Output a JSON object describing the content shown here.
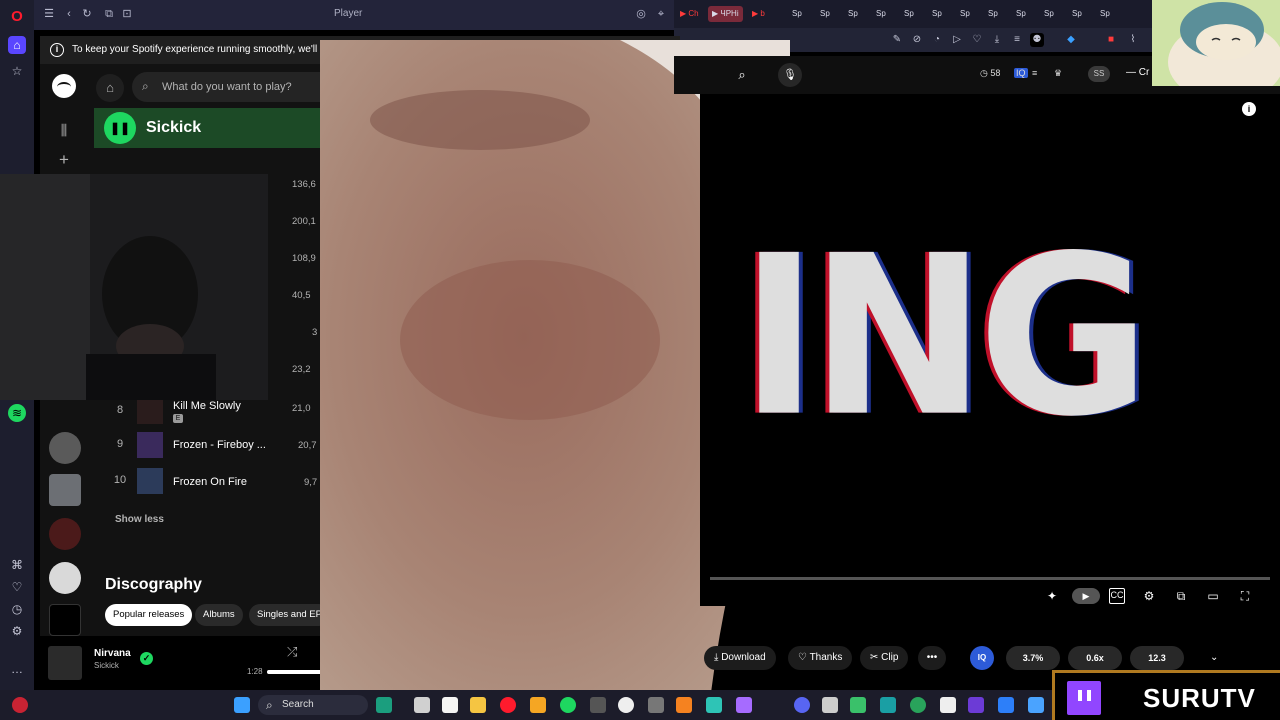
{
  "browser": {
    "page_title": "Player",
    "tabs": [
      "Sp",
      "Sp",
      "Sp",
      "Sp",
      "Sp",
      "Sp",
      "Sp",
      "Sp",
      "Sp",
      "Sp",
      "Sp",
      "Sp"
    ]
  },
  "spotify": {
    "notice": "To keep your Spotify experience running smoothly, we'll pa",
    "search_placeholder": "What do you want to play?",
    "artist": "Sickick",
    "tracks": [
      {
        "num": "8",
        "title": "Kill Me Slowly",
        "plays": "21,0",
        "explicit": "E"
      },
      {
        "num": "9",
        "title": "Frozen - Fireboy ...",
        "plays": "20,7"
      },
      {
        "num": "10",
        "title": "Frozen On Fire",
        "plays": "9,7"
      }
    ],
    "partial_plays": [
      "136,6",
      "200,1",
      "108,9",
      "40,5",
      "3",
      "23,2"
    ],
    "show_less": "Show less",
    "discography_title": "Discography",
    "chips": [
      "Popular releases",
      "Albums",
      "Singles and EP"
    ],
    "now_playing": {
      "title": "Nirvana",
      "artist": "Sickick",
      "time": "1:28",
      "progress": 0.22
    }
  },
  "youtube": {
    "stats": {
      "views": "58"
    },
    "badge": "SS",
    "create": "Cr",
    "video_text": "ING",
    "actions": {
      "download": "Download",
      "thanks": "Thanks",
      "clip": "Clip",
      "more": "•••"
    },
    "metrics": [
      "3.7%",
      "0.6x",
      "12.3"
    ],
    "iq": "IQ"
  },
  "taskbar": {
    "search": "Search"
  },
  "twitch": {
    "channel": "SURUTV"
  },
  "colors": {
    "spotify_green": "#1ed760",
    "twitch_purple": "#9146ff",
    "opera_red": "#ff1b2d"
  }
}
